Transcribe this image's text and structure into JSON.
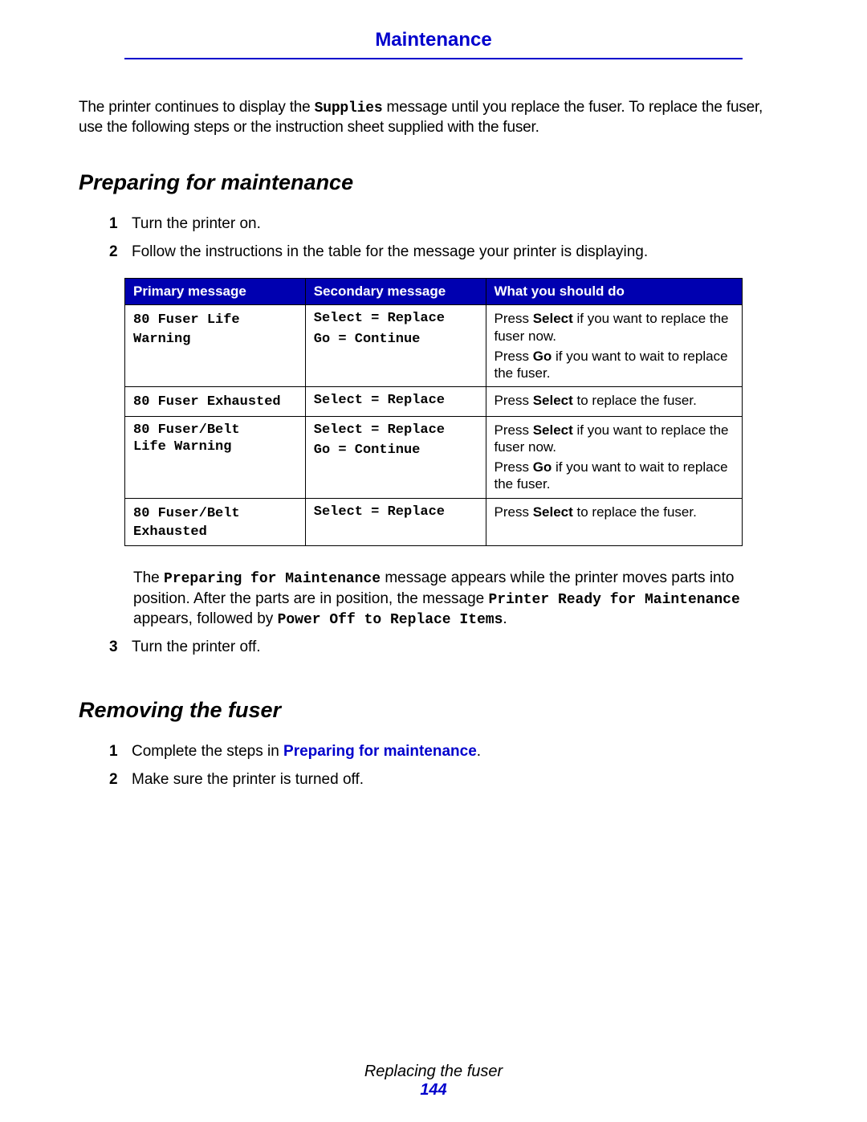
{
  "header": {
    "title": "Maintenance"
  },
  "intro": {
    "part1": "The printer continues to display the ",
    "mono1": "Supplies",
    "part2": " message until you replace the fuser. To replace the fuser, use the following steps or the instruction sheet supplied with the fuser."
  },
  "section1": {
    "heading": "Preparing for maintenance",
    "steps": {
      "s1": {
        "num": "1",
        "text": "Turn the printer on."
      },
      "s2": {
        "num": "2",
        "text": "Follow the instructions in the table for the message your printer is displaying."
      },
      "s3": {
        "num": "3",
        "text": "Turn the printer off."
      }
    },
    "note": {
      "p1": "The ",
      "m1": "Preparing for Maintenance",
      "p2": " message appears while the printer moves parts into position. After the parts are in position, the message ",
      "m2": "Printer Ready for Maintenance",
      "p3": " appears, followed by ",
      "m3": "Power Off to Replace Items",
      "p4": "."
    }
  },
  "table": {
    "headers": {
      "h1": "Primary message",
      "h2": "Secondary message",
      "h3": "What you should do"
    },
    "rows": {
      "r1": {
        "primary": "80 Fuser Life Warning",
        "secondary_line1": "Select = Replace",
        "secondary_line2": "Go = Continue",
        "action_p1": "Press ",
        "action_b1": "Select",
        "action_p2": " if you want to replace the fuser now.",
        "action_p3": "Press ",
        "action_b2": "Go",
        "action_p4": " if you want to wait to replace the fuser."
      },
      "r2": {
        "primary": "80 Fuser Exhausted",
        "secondary_line1": "Select = Replace",
        "action_p1": "Press ",
        "action_b1": "Select",
        "action_p2": " to replace the fuser."
      },
      "r3": {
        "primary_line1": "80 Fuser/Belt",
        "primary_line2": "Life Warning",
        "secondary_line1": "Select = Replace",
        "secondary_line2": "Go = Continue",
        "action_p1": "Press ",
        "action_b1": "Select",
        "action_p2": " if you want to replace the fuser now.",
        "action_p3": "Press ",
        "action_b2": "Go",
        "action_p4": " if you want to wait to replace the fuser."
      },
      "r4": {
        "primary": "80 Fuser/Belt Exhausted",
        "secondary_line1": "Select = Replace",
        "action_p1": "Press ",
        "action_b1": "Select",
        "action_p2": " to replace the fuser."
      }
    }
  },
  "section2": {
    "heading": "Removing the fuser",
    "steps": {
      "s1": {
        "num": "1",
        "p1": "Complete the steps in ",
        "link": "Preparing for maintenance",
        "p2": "."
      },
      "s2": {
        "num": "2",
        "text": "Make sure the printer is turned off."
      }
    }
  },
  "footer": {
    "title": "Replacing the fuser",
    "page": "144"
  }
}
